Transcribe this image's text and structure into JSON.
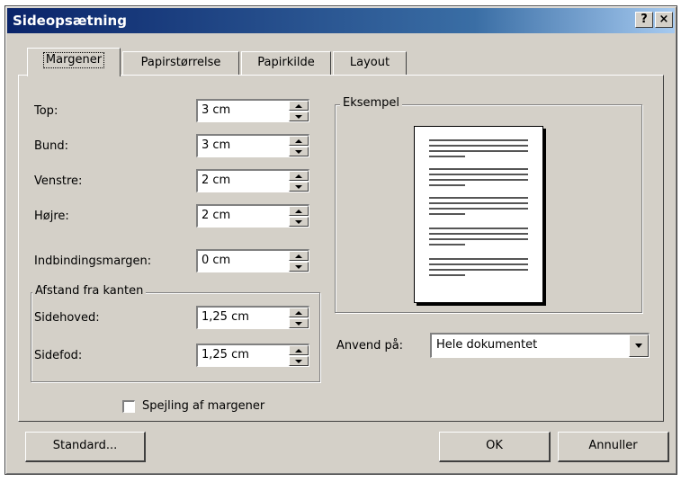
{
  "dialog": {
    "title": "Sideopsætning",
    "help_button": "?",
    "close_button": "×"
  },
  "tabs": [
    {
      "label": "Margener",
      "active": true
    },
    {
      "label": "Papirstørrelse",
      "active": false
    },
    {
      "label": "Papirkilde",
      "active": false
    },
    {
      "label": "Layout",
      "active": false
    }
  ],
  "margins": {
    "top": {
      "label": "Top:",
      "value": "3 cm"
    },
    "bottom": {
      "label": "Bund:",
      "value": "3 cm"
    },
    "left": {
      "label": "Venstre:",
      "value": "2 cm"
    },
    "right": {
      "label": "Højre:",
      "value": "2 cm"
    },
    "gutter": {
      "label": "Indbindingsmargen:",
      "value": "0 cm"
    }
  },
  "edge_distance": {
    "title": "Afstand fra kanten",
    "header": {
      "label": "Sidehoved:",
      "value": "1,25 cm"
    },
    "footer": {
      "label": "Sidefod:",
      "value": "1,25 cm"
    }
  },
  "preview": {
    "title": "Eksempel"
  },
  "apply_to": {
    "label": "Anvend på:",
    "selected": "Hele dokumentet"
  },
  "mirror_margins": {
    "label": "Spejling af margener",
    "checked": false
  },
  "buttons": {
    "default": "Standard...",
    "ok": "OK",
    "cancel": "Annuller"
  },
  "colors": {
    "face": "#d4d0c8",
    "title_start": "#0a246a",
    "title_end": "#a6caf0"
  }
}
